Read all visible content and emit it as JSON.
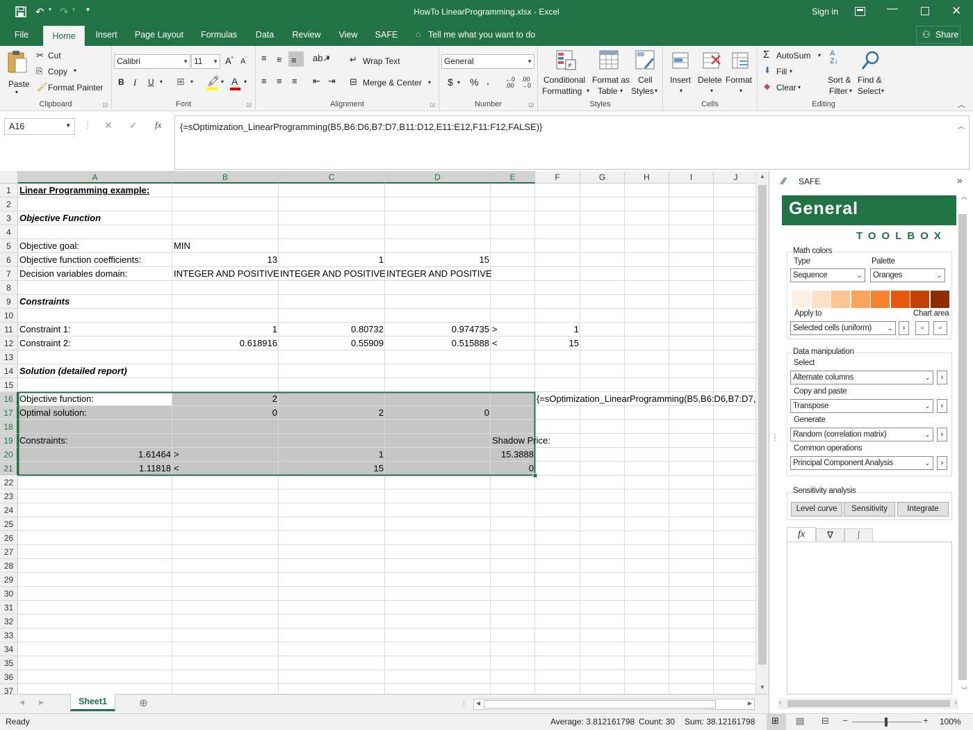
{
  "window": {
    "title": "HowTo LinearProgramming.xlsx - Excel",
    "signin": "Sign in",
    "share": "Share"
  },
  "tabs": [
    "File",
    "Home",
    "Insert",
    "Page Layout",
    "Formulas",
    "Data",
    "Review",
    "View",
    "SAFE"
  ],
  "tellme": "Tell me what you want to do",
  "ribbon": {
    "clipboard": {
      "label": "Clipboard",
      "paste": "Paste",
      "cut": "Cut",
      "copy": "Copy",
      "painter": "Format Painter"
    },
    "font": {
      "label": "Font",
      "name": "Calibri",
      "size": "11"
    },
    "alignment": {
      "label": "Alignment",
      "wrap": "Wrap Text",
      "merge": "Merge & Center"
    },
    "number": {
      "label": "Number",
      "format": "General"
    },
    "styles": {
      "label": "Styles",
      "cond1": "Conditional",
      "cond2": "Formatting",
      "fmt1": "Format as",
      "fmt2": "Table",
      "cell1": "Cell",
      "cell2": "Styles"
    },
    "cells": {
      "label": "Cells",
      "insert": "Insert",
      "delete": "Delete",
      "format": "Format"
    },
    "editing": {
      "label": "Editing",
      "autosum": "AutoSum",
      "fill": "Fill",
      "clear": "Clear",
      "sort1": "Sort &",
      "sort2": "Filter",
      "find1": "Find &",
      "find2": "Select"
    }
  },
  "namebox": "A16",
  "formula": "{=sOptimization_LinearProgramming(B5,B6:D6,B7:D7,B11:D12,E11:E12,F11:F12,FALSE)}",
  "columns": [
    "A",
    "B",
    "C",
    "D",
    "E",
    "F",
    "G",
    "H",
    "I",
    "J"
  ],
  "rows": [
    "1",
    "2",
    "3",
    "4",
    "5",
    "6",
    "7",
    "8",
    "9",
    "10",
    "11",
    "12",
    "13",
    "14",
    "15",
    "16",
    "17",
    "18",
    "19",
    "20",
    "21",
    "22",
    "23",
    "24",
    "25",
    "26",
    "27",
    "28",
    "29",
    "30",
    "31",
    "32",
    "33",
    "34",
    "35",
    "36",
    "37"
  ],
  "cells": [
    {
      "r": 1,
      "c": "A",
      "v": "Linear Programming example:",
      "s": "bold und"
    },
    {
      "r": 3,
      "c": "A",
      "v": "Objective Function",
      "s": "bold ital"
    },
    {
      "r": 5,
      "c": "A",
      "v": "Objective goal:"
    },
    {
      "r": 5,
      "c": "B",
      "v": "MIN"
    },
    {
      "r": 6,
      "c": "A",
      "v": "Objective function coefficients:"
    },
    {
      "r": 6,
      "c": "B",
      "v": "13",
      "s": "r"
    },
    {
      "r": 6,
      "c": "C",
      "v": "1",
      "s": "r"
    },
    {
      "r": 6,
      "c": "D",
      "v": "15",
      "s": "r"
    },
    {
      "r": 7,
      "c": "A",
      "v": "Decision variables domain:"
    },
    {
      "r": 7,
      "c": "B",
      "v": "INTEGER AND POSITIVE"
    },
    {
      "r": 7,
      "c": "C",
      "v": "INTEGER AND POSITIVE"
    },
    {
      "r": 7,
      "c": "D",
      "v": "INTEGER AND POSITIVE"
    },
    {
      "r": 9,
      "c": "A",
      "v": "Constraints",
      "s": "bold ital"
    },
    {
      "r": 11,
      "c": "A",
      "v": "Constraint 1:"
    },
    {
      "r": 11,
      "c": "B",
      "v": "1",
      "s": "r"
    },
    {
      "r": 11,
      "c": "C",
      "v": "0.80732",
      "s": "r"
    },
    {
      "r": 11,
      "c": "D",
      "v": "0.974735",
      "s": "r"
    },
    {
      "r": 11,
      "c": "E",
      "v": ">"
    },
    {
      "r": 11,
      "c": "F",
      "v": "1",
      "s": "r"
    },
    {
      "r": 12,
      "c": "A",
      "v": "Constraint 2:"
    },
    {
      "r": 12,
      "c": "B",
      "v": "0.618916",
      "s": "r"
    },
    {
      "r": 12,
      "c": "C",
      "v": "0.55909",
      "s": "r"
    },
    {
      "r": 12,
      "c": "D",
      "v": "0.515888",
      "s": "r"
    },
    {
      "r": 12,
      "c": "E",
      "v": "<"
    },
    {
      "r": 12,
      "c": "F",
      "v": "15",
      "s": "r"
    },
    {
      "r": 14,
      "c": "A",
      "v": "Solution (detailed report)",
      "s": "bold ital"
    },
    {
      "r": 16,
      "c": "A",
      "v": "Objective function:"
    },
    {
      "r": 16,
      "c": "B",
      "v": "2",
      "s": "r"
    },
    {
      "r": 16,
      "c": "F",
      "v": "{=sOptimization_LinearProgramming(B5,B6:D6,B7:D7,B11:D12,E11:E12,F11:F12,FALSE)}"
    },
    {
      "r": 17,
      "c": "A",
      "v": "Optimal solution:"
    },
    {
      "r": 17,
      "c": "B",
      "v": "0",
      "s": "r"
    },
    {
      "r": 17,
      "c": "C",
      "v": "2",
      "s": "r"
    },
    {
      "r": 17,
      "c": "D",
      "v": "0",
      "s": "r"
    },
    {
      "r": 19,
      "c": "A",
      "v": "Constraints:"
    },
    {
      "r": 19,
      "c": "E",
      "v": "Shadow Price:"
    },
    {
      "r": 20,
      "c": "A",
      "v": "1.61464",
      "s": "r"
    },
    {
      "r": 20,
      "c": "B",
      "v": ">"
    },
    {
      "r": 20,
      "c": "C",
      "v": "1",
      "s": "r"
    },
    {
      "r": 20,
      "c": "E",
      "v": "15.3888",
      "s": "r"
    },
    {
      "r": 21,
      "c": "A",
      "v": "1.11818",
      "s": "r"
    },
    {
      "r": 21,
      "c": "B",
      "v": "<"
    },
    {
      "r": 21,
      "c": "C",
      "v": "15",
      "s": "r"
    },
    {
      "r": 21,
      "c": "E",
      "v": "0",
      "s": "r"
    }
  ],
  "sheet": {
    "name": "Sheet1"
  },
  "status": {
    "ready": "Ready",
    "average": "Average: 3.812161798",
    "count": "Count: 30",
    "sum": "Sum: 38.12161798",
    "zoom": "100%"
  },
  "pane": {
    "title": "SAFE",
    "banner": "General",
    "toolbox": "TOOLBOX",
    "mathcolors": "Math colors",
    "type_label": "Type",
    "type_value": "Sequence",
    "palette_label": "Palette",
    "palette_value": "Oranges",
    "swatches": [
      "#fdf0e4",
      "#fde0c5",
      "#fcc393",
      "#fca45c",
      "#f8812f",
      "#e6580c",
      "#c24103",
      "#8e2d04"
    ],
    "apply_label": "Apply to",
    "chart_area": "Chart area",
    "apply_value": "Selected cells (uniform)",
    "datamanip": "Data manipulation",
    "select_label": "Select",
    "select_value": "Alternate columns",
    "copy_label": "Copy and paste",
    "copy_value": "Transpose",
    "gen_label": "Generate",
    "gen_value": "Random (correlation matrix)",
    "ops_label": "Common operations",
    "ops_value": "Principal Component Analysis",
    "sens": "Sensitivity analysis",
    "btn_level": "Level curve",
    "btn_sens": "Sensitivity",
    "btn_int": "Integrate"
  }
}
